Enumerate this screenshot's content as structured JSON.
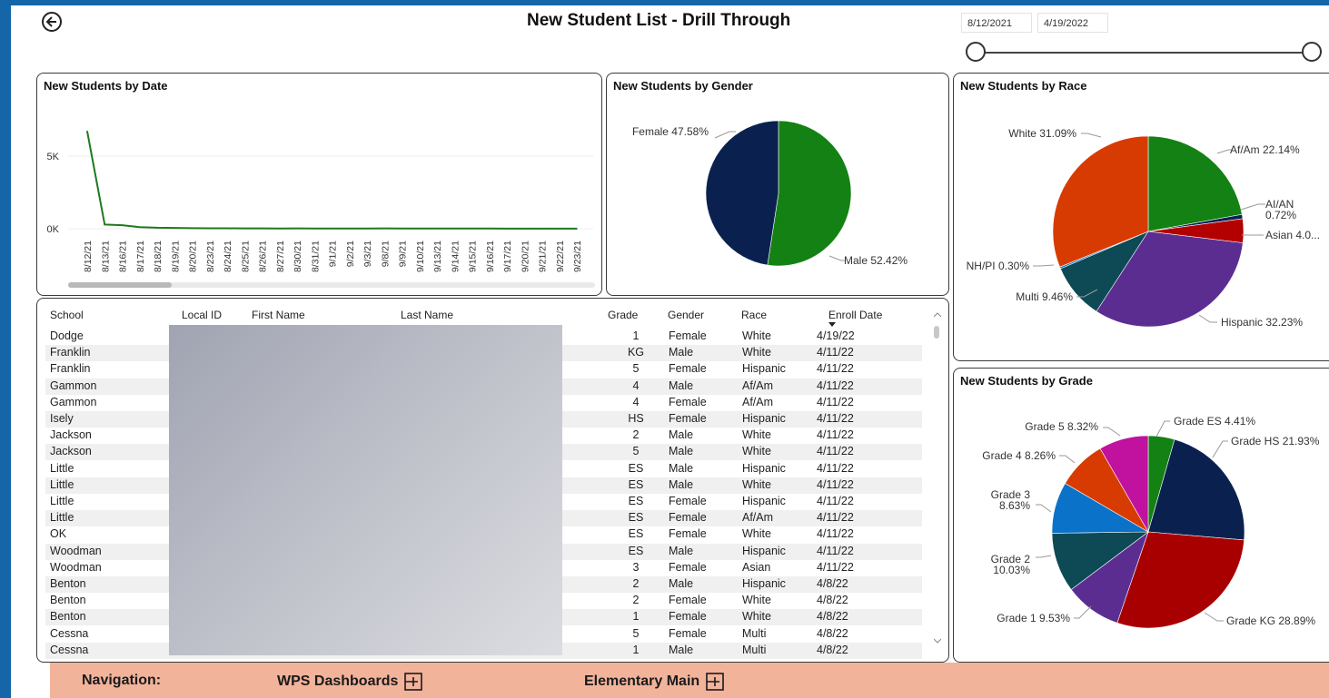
{
  "page": {
    "title": "New Student List - Drill Through",
    "date_start": "8/12/2021",
    "date_end": "4/19/2022"
  },
  "panels": {
    "by_date_title": "New Students by Date",
    "by_gender_title": "New Students by Gender",
    "by_race_title": "New Students by Race",
    "by_grade_title": "New Students by Grade"
  },
  "chart_data": [
    {
      "type": "line",
      "title": "New Students by Date",
      "x": [
        "8/12/21",
        "8/13/21",
        "8/16/21",
        "8/17/21",
        "8/18/21",
        "8/19/21",
        "8/20/21",
        "8/23/21",
        "8/24/21",
        "8/25/21",
        "8/26/21",
        "8/27/21",
        "8/30/21",
        "8/31/21",
        "9/1/21",
        "9/2/21",
        "9/3/21",
        "9/8/21",
        "9/9/21",
        "9/10/21",
        "9/13/21",
        "9/14/21",
        "9/15/21",
        "9/16/21",
        "9/17/21",
        "9/20/21",
        "9/21/21",
        "9/22/21",
        "9/23/21"
      ],
      "yticks": [
        "0K",
        "5K"
      ],
      "series": [
        {
          "values": [
            6700,
            300,
            250,
            120,
            80,
            70,
            50,
            40,
            40,
            35,
            35,
            30,
            35,
            30,
            30,
            28,
            28,
            35,
            30,
            28,
            30,
            28,
            25,
            25,
            22,
            20,
            20,
            18,
            18
          ]
        }
      ],
      "color": "#1e7a1e",
      "ylim": [
        -300,
        8800
      ]
    },
    {
      "type": "pie",
      "title": "New Students by Gender",
      "labels": [
        "Male 52.42%",
        "Female 47.58%"
      ],
      "values": [
        52.42,
        47.58
      ],
      "colors": [
        "#138113",
        "#0a2150"
      ]
    },
    {
      "type": "pie",
      "title": "New Students by Race",
      "labels": [
        "Af/Am 22.14%",
        "AI/AN 0.72%",
        "Asian 4.0...",
        "Hispanic 32.23%",
        "Multi 9.46%",
        "NH/PI 0.30%",
        "White 31.09%"
      ],
      "values": [
        22.14,
        0.72,
        4.06,
        32.23,
        9.46,
        0.3,
        31.09
      ],
      "colors": [
        "#138113",
        "#0a2150",
        "#b30000",
        "#5c2d91",
        "#0d4a55",
        "#0a72c8",
        "#d83b01"
      ]
    },
    {
      "type": "pie",
      "title": "New Students by Grade",
      "labels": [
        "Grade ES 4.41%",
        "Grade HS 21.93%",
        "Grade KG 28.89%",
        "Grade 1 9.53%",
        "Grade 2 10.03%",
        "Grade 3 8.63%",
        "Grade 4 8.26%",
        "Grade 5 8.32%"
      ],
      "values": [
        4.41,
        21.93,
        28.89,
        9.53,
        10.03,
        8.63,
        8.26,
        8.32
      ],
      "colors": [
        "#138113",
        "#0a2150",
        "#a80000",
        "#5c2d91",
        "#0d4a55",
        "#0a72c8",
        "#d83b01",
        "#c0119f"
      ]
    }
  ],
  "table": {
    "columns": [
      "School",
      "Local ID",
      "First Name",
      "Last Name",
      "Grade",
      "Gender",
      "Race",
      "Enroll Date"
    ],
    "rows": [
      [
        "Dodge",
        "1",
        "Female",
        "White",
        "4/19/22"
      ],
      [
        "Franklin",
        "KG",
        "Male",
        "White",
        "4/11/22"
      ],
      [
        "Franklin",
        "5",
        "Female",
        "Hispanic",
        "4/11/22"
      ],
      [
        "Gammon",
        "4",
        "Male",
        "Af/Am",
        "4/11/22"
      ],
      [
        "Gammon",
        "4",
        "Female",
        "Af/Am",
        "4/11/22"
      ],
      [
        "Isely",
        "HS",
        "Female",
        "Hispanic",
        "4/11/22"
      ],
      [
        "Jackson",
        "2",
        "Male",
        "White",
        "4/11/22"
      ],
      [
        "Jackson",
        "5",
        "Male",
        "White",
        "4/11/22"
      ],
      [
        "Little",
        "ES",
        "Male",
        "Hispanic",
        "4/11/22"
      ],
      [
        "Little",
        "ES",
        "Male",
        "White",
        "4/11/22"
      ],
      [
        "Little",
        "ES",
        "Female",
        "Hispanic",
        "4/11/22"
      ],
      [
        "Little",
        "ES",
        "Female",
        "Af/Am",
        "4/11/22"
      ],
      [
        "OK",
        "ES",
        "Female",
        "White",
        "4/11/22"
      ],
      [
        "Woodman",
        "ES",
        "Male",
        "Hispanic",
        "4/11/22"
      ],
      [
        "Woodman",
        "3",
        "Female",
        "Asian",
        "4/11/22"
      ],
      [
        "Benton",
        "2",
        "Male",
        "Hispanic",
        "4/8/22"
      ],
      [
        "Benton",
        "2",
        "Female",
        "White",
        "4/8/22"
      ],
      [
        "Benton",
        "1",
        "Female",
        "White",
        "4/8/22"
      ],
      [
        "Cessna",
        "5",
        "Female",
        "Multi",
        "4/8/22"
      ],
      [
        "Cessna",
        "1",
        "Male",
        "Multi",
        "4/8/22"
      ]
    ]
  },
  "navigation": {
    "label": "Navigation:",
    "link1": "WPS Dashboards",
    "link2": "Elementary Main"
  },
  "icons": {
    "back": "back-arrow-icon",
    "drill": "expand-square-icon"
  }
}
